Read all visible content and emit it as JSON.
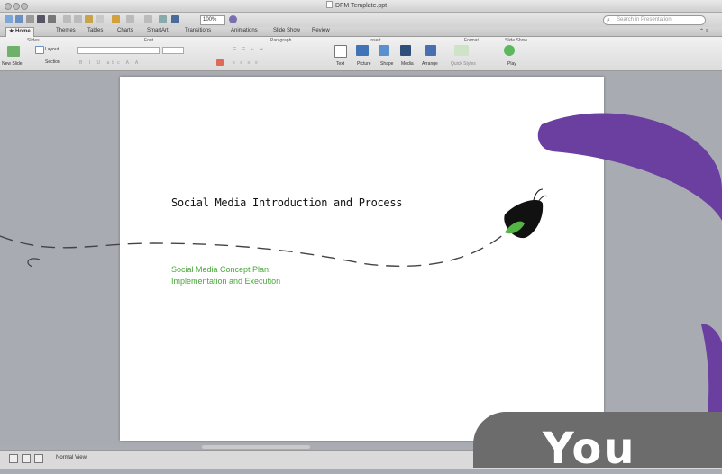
{
  "window": {
    "title": "DFM Template.ppt"
  },
  "toolbar": {
    "zoom": "100%",
    "search_placeholder": "Search in Presentation"
  },
  "tabs": [
    "Home",
    "Themes",
    "Tables",
    "Charts",
    "SmartArt",
    "Transitions",
    "Animations",
    "Slide Show",
    "Review"
  ],
  "ribbon": {
    "groups": [
      "Slides",
      "Font",
      "Paragraph",
      "Insert",
      "Format",
      "Slide Show"
    ],
    "slides": {
      "new_slide": "New Slide",
      "layout": "Layout",
      "section": "Section"
    },
    "insert": [
      "Text",
      "Picture",
      "Shape",
      "Media"
    ],
    "format": [
      "Arrange",
      "Quick Styles"
    ],
    "slideshow": [
      "Play"
    ]
  },
  "slide": {
    "title": "Social Media Introduction and Process",
    "subtitle_line1": "Social Media Concept Plan:",
    "subtitle_line2": "Implementation and Execution"
  },
  "statusbar": {
    "view": "Normal View"
  },
  "overlay": {
    "text": "You"
  },
  "colors": {
    "accent_purple": "#6a3fa0",
    "leaf_green": "#55b446",
    "subtitle_green": "#49a83a"
  }
}
